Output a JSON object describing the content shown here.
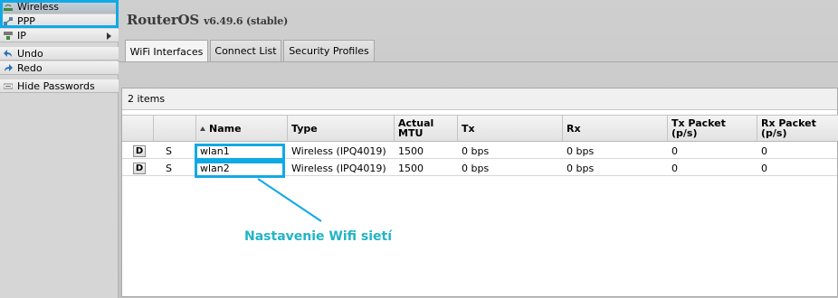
{
  "sidebar": {
    "items": [
      {
        "label": "Wireless",
        "icon": "wireless-icon"
      },
      {
        "label": "PPP",
        "icon": "ppp-icon"
      },
      {
        "label": "IP",
        "icon": "ip-icon"
      },
      {
        "label": "Undo",
        "icon": "undo-icon"
      },
      {
        "label": "Redo",
        "icon": "redo-icon"
      },
      {
        "label": "Hide Passwords",
        "icon": "hide-passwords-icon"
      }
    ]
  },
  "header": {
    "title": "RouterOS",
    "version": "v6.49.6 (stable)"
  },
  "tabs": [
    {
      "label": "WiFi Interfaces"
    },
    {
      "label": "Connect List"
    },
    {
      "label": "Security Profiles"
    }
  ],
  "table": {
    "item_count": "2 items",
    "columns": [
      "",
      "",
      "Name",
      "Type",
      "Actual MTU",
      "Tx",
      "Rx",
      "Tx Packet (p/s)",
      "Rx Packet (p/s)"
    ],
    "rows": [
      {
        "btn": "D",
        "flag": "S",
        "name": "wlan1",
        "type": "Wireless (IPQ4019)",
        "mtu": "1500",
        "tx": "0 bps",
        "rx": "0 bps",
        "tx_pps": "0",
        "rx_pps": "0"
      },
      {
        "btn": "D",
        "flag": "S",
        "name": "wlan2",
        "type": "Wireless (IPQ4019)",
        "mtu": "1500",
        "tx": "0 bps",
        "rx": "0 bps",
        "tx_pps": "0",
        "rx_pps": "0"
      }
    ]
  },
  "annotation": {
    "text": "Nastavenie Wifi sietí"
  },
  "colors": {
    "highlight": "#11a9e5",
    "annotation_text": "#21b4c6"
  }
}
